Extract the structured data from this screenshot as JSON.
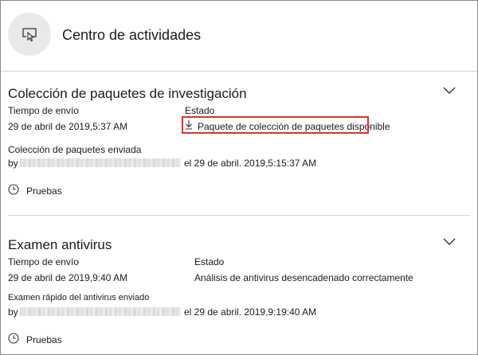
{
  "header": {
    "title": "Centro de actividades",
    "icon": "remote-pointer-icon"
  },
  "sections": [
    {
      "title": "Colección de paquetes de investigación",
      "submit_label": "Tiempo de envío",
      "submit_value": "29 de abril de 2019,5:37 AM",
      "status_label": "Estado",
      "status_value": "Paquete de colección de paquetes disponible",
      "activity": "Colección de paquetes enviada",
      "by_label": "by",
      "by_date": "el 29 de abril. 2019,5:15:37 AM",
      "evidence": "Pruebas"
    },
    {
      "title": "Examen antivirus",
      "submit_label": "Tiempo de envío",
      "submit_value": "29 de abril de 2019,9:40 AM",
      "status_label": "Estado",
      "status_value": "Análisis de antivirus desencadenado correctamente",
      "activity": "Examen rápido del antivirus enviado",
      "by_label": "by",
      "by_date": "el 29 de abril. 2019,9:19:40 AM",
      "evidence": "Pruebas"
    }
  ],
  "colors": {
    "highlight": "#e0302b",
    "separator": "#d4d4d4",
    "icon_bg": "#e9e9e9"
  }
}
